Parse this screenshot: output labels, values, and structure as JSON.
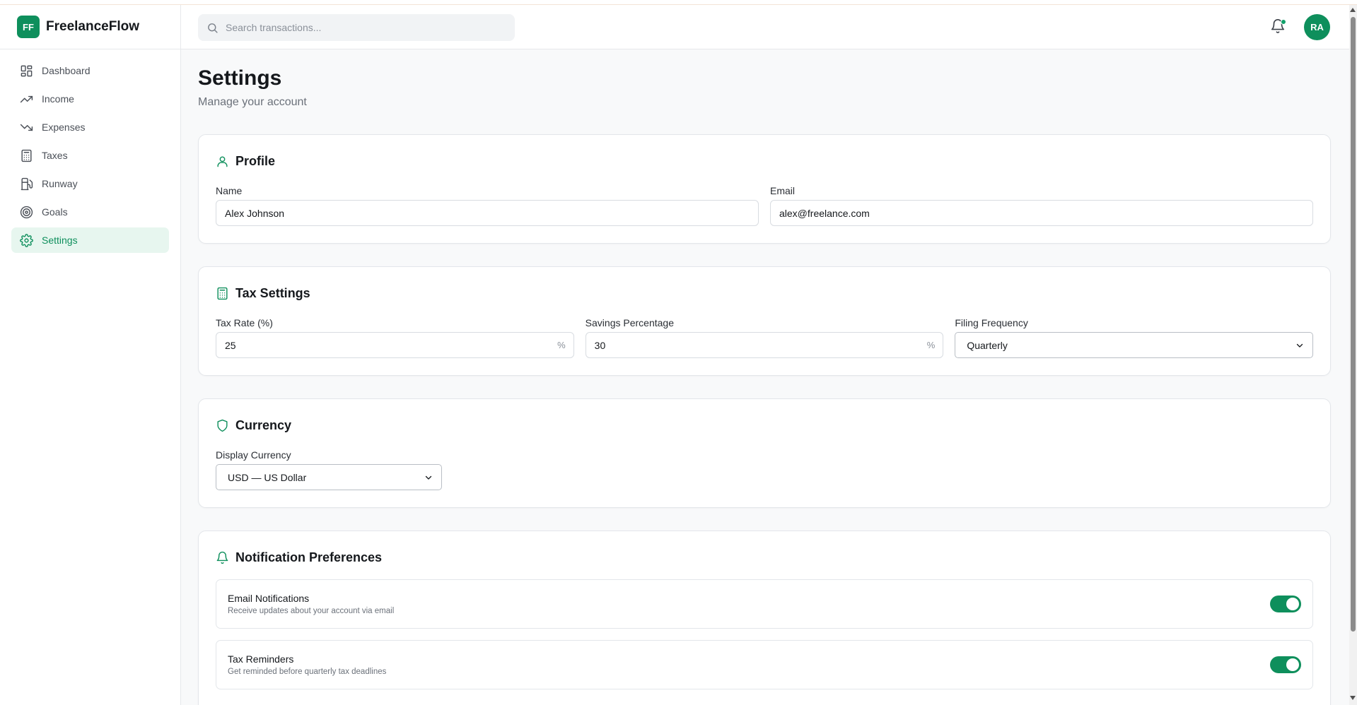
{
  "brand": {
    "logo": "FF",
    "name": "FreelanceFlow"
  },
  "sidebar": {
    "items": [
      {
        "label": "Dashboard",
        "icon": "dashboard-icon",
        "active": false
      },
      {
        "label": "Income",
        "icon": "trending-up-icon",
        "active": false
      },
      {
        "label": "Expenses",
        "icon": "trending-down-icon",
        "active": false
      },
      {
        "label": "Taxes",
        "icon": "calculator-icon",
        "active": false
      },
      {
        "label": "Runway",
        "icon": "fuel-icon",
        "active": false
      },
      {
        "label": "Goals",
        "icon": "target-icon",
        "active": false
      },
      {
        "label": "Settings",
        "icon": "gear-icon",
        "active": true
      }
    ]
  },
  "header": {
    "search_placeholder": "Search transactions...",
    "avatar_initials": "RA",
    "notification_dot": true
  },
  "page": {
    "title": "Settings",
    "subtitle": "Manage your account"
  },
  "profile": {
    "title": "Profile",
    "name_label": "Name",
    "name_value": "Alex Johnson",
    "email_label": "Email",
    "email_value": "alex@freelance.com"
  },
  "tax": {
    "title": "Tax Settings",
    "rate_label": "Tax Rate (%)",
    "rate_value": "25",
    "rate_suffix": "%",
    "savings_label": "Savings Percentage",
    "savings_value": "30",
    "savings_suffix": "%",
    "frequency_label": "Filing Frequency",
    "frequency_value": "Quarterly"
  },
  "currency": {
    "title": "Currency",
    "display_label": "Display Currency",
    "display_value": "USD — US Dollar"
  },
  "notifications": {
    "title": "Notification Preferences",
    "items": [
      {
        "title": "Email Notifications",
        "desc": "Receive updates about your account via email",
        "enabled": true
      },
      {
        "title": "Tax Reminders",
        "desc": "Get reminded before quarterly tax deadlines",
        "enabled": true
      }
    ]
  },
  "colors": {
    "accent": "#0e8f5c",
    "accent_light": "#e7f6ef",
    "background": "#f8f9fa",
    "border": "#e3e6ea"
  }
}
